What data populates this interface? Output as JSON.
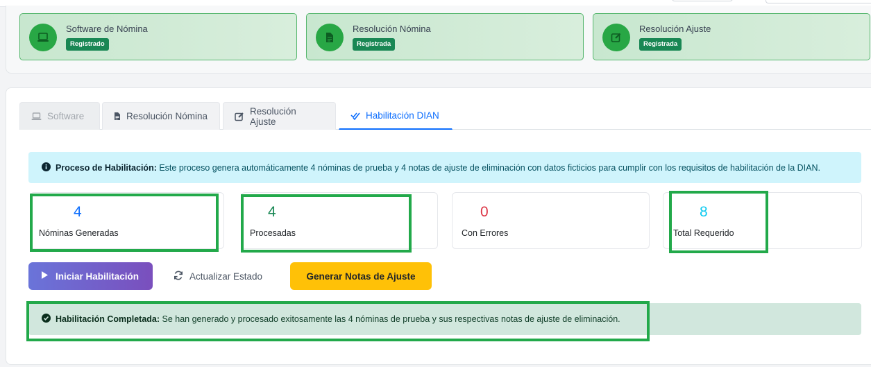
{
  "status_cards": [
    {
      "title": "Software de Nómina",
      "badge": "Registrado",
      "icon": "laptop-icon"
    },
    {
      "title": "Resolución Nómina",
      "badge": "Registrada",
      "icon": "file-icon"
    },
    {
      "title": "Resolución Ajuste",
      "badge": "Registrada",
      "icon": "edit-icon"
    }
  ],
  "tabs": [
    {
      "label": "Software",
      "icon": "laptop-icon",
      "state": "disabled"
    },
    {
      "label": "Resolución Nómina",
      "icon": "file-icon",
      "state": "normal"
    },
    {
      "label": "Resolución Ajuste",
      "icon": "edit-icon",
      "state": "normal"
    },
    {
      "label": "Habilitación DIAN",
      "icon": "double-check-icon",
      "state": "active"
    }
  ],
  "info": {
    "title": "Proceso de Habilitación:",
    "text": " Este proceso genera automáticamente 4 nóminas de prueba y 4 notas de ajuste de eliminación con datos ficticios para cumplir con los requisitos de habilitación de la DIAN."
  },
  "stats": [
    {
      "value": "4",
      "label": "Nóminas Generadas",
      "color": "#0d6efd"
    },
    {
      "value": "4",
      "label": "Procesadas",
      "color": "#198754"
    },
    {
      "value": "0",
      "label": "Con Errores",
      "color": "#dc3545"
    },
    {
      "value": "8",
      "label": "Total Requerido",
      "color": "#0dcaf0"
    }
  ],
  "actions": {
    "start": "Iniciar Habilitación",
    "refresh": "Actualizar Estado",
    "generate": "Generar Notas de Ajuste"
  },
  "success": {
    "title": "Habilitación Completada:",
    "text": " Se han generado y procesado exitosamente las 4 nóminas de prueba y sus respectivas notas de ajuste de eliminación."
  },
  "colors": {
    "success_green": "#28a745",
    "badge_green": "#198754",
    "primary_blue": "#0d6efd",
    "warning_yellow": "#ffc107",
    "highlight_green": "#22a94a"
  }
}
